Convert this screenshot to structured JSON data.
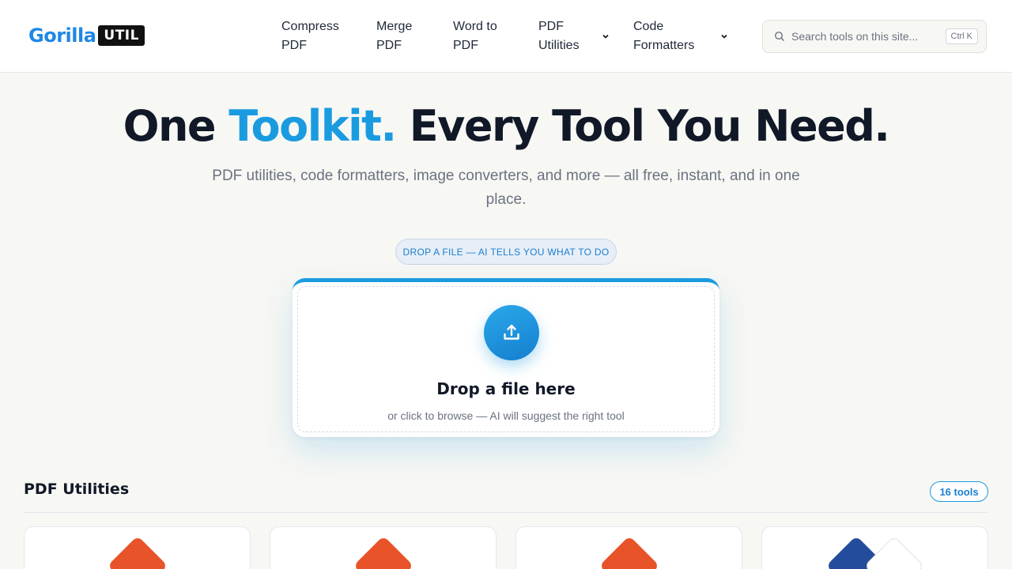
{
  "header": {
    "logo_main": "Gorilla",
    "logo_badge": "UTIL",
    "nav": [
      {
        "label": "Compress PDF",
        "has_dropdown": false
      },
      {
        "label": "Merge PDF",
        "has_dropdown": false
      },
      {
        "label": "Word to PDF",
        "has_dropdown": false
      },
      {
        "label": "PDF Utilities",
        "has_dropdown": true
      },
      {
        "label": "Code Formatters",
        "has_dropdown": true
      }
    ],
    "search": {
      "placeholder": "Search tools on this site...",
      "shortcut": "Ctrl K"
    }
  },
  "hero": {
    "title_part1": "One ",
    "title_accent": "Toolkit.",
    "title_part2": " Every Tool You Need.",
    "subtitle": "PDF utilities, code formatters, image converters, and more — all free, instant, and in one place.",
    "pill": "DROP A FILE — AI TELLS YOU WHAT TO DO"
  },
  "dropzone": {
    "title": "Drop a file here",
    "subtitle": "or click to browse — AI will suggest the right tool"
  },
  "section": {
    "title": "PDF Utilities",
    "count": "16 tools"
  },
  "colors": {
    "accent": "#1a9be0",
    "pdf_orange": "#e8532a",
    "word_blue": "#234d9c"
  }
}
